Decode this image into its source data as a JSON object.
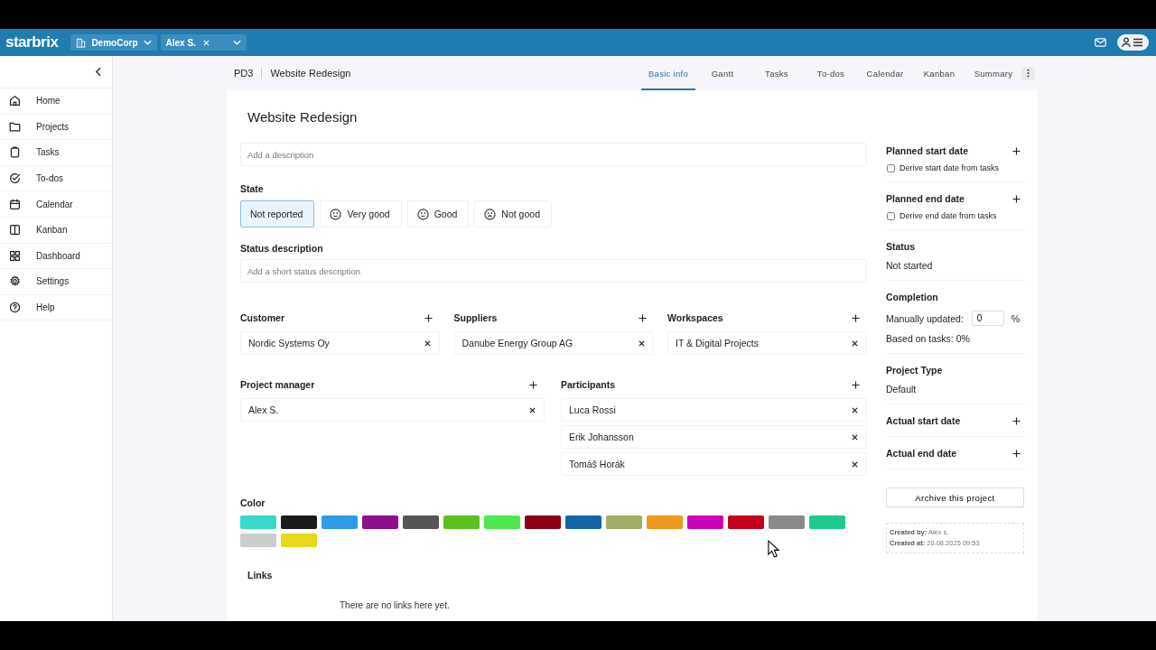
{
  "topbar": {
    "logo": "starbrix",
    "org": "DemoCorp",
    "user_filter": "Alex S."
  },
  "sidebar": {
    "items": [
      {
        "label": "Home"
      },
      {
        "label": "Projects"
      },
      {
        "label": "Tasks"
      },
      {
        "label": "To-dos"
      },
      {
        "label": "Calendar"
      },
      {
        "label": "Kanban"
      },
      {
        "label": "Dashboard"
      },
      {
        "label": "Settings"
      },
      {
        "label": "Help"
      }
    ]
  },
  "project": {
    "code": "PD3",
    "title": "Website Redesign"
  },
  "tabs": [
    {
      "label": "Basic info",
      "selected": true
    },
    {
      "label": "Gantt",
      "selected": false
    },
    {
      "label": "Tasks",
      "selected": false
    },
    {
      "label": "To-dos",
      "selected": false
    },
    {
      "label": "Calendar",
      "selected": false
    },
    {
      "label": "Kanban",
      "selected": false
    },
    {
      "label": "Summary",
      "selected": false
    }
  ],
  "form": {
    "title": "Website Redesign",
    "description_placeholder": "Add a description",
    "state_label": "State",
    "states": [
      {
        "label": "Not reported",
        "selected": true,
        "kind": "plain"
      },
      {
        "label": "Very good",
        "selected": false,
        "kind": "happy"
      },
      {
        "label": "Good",
        "selected": false,
        "kind": "neutral"
      },
      {
        "label": "Not good",
        "selected": false,
        "kind": "sad"
      }
    ],
    "status_description_label": "Status description",
    "status_description_placeholder": "Add a short status description",
    "groups": [
      {
        "label": "Customer",
        "items": [
          "Nordic Systems Oy"
        ]
      },
      {
        "label": "Suppliers",
        "items": [
          "Danube Energy Group AG"
        ]
      },
      {
        "label": "Workspaces",
        "items": [
          "IT & Digital Projects"
        ]
      }
    ],
    "people": [
      {
        "label": "Project manager",
        "items": [
          "Alex S."
        ]
      },
      {
        "label": "Participants",
        "items": [
          "Luca Rossi",
          "Erik Johansson",
          "Tomáš Horák"
        ]
      }
    ],
    "color_label": "Color",
    "swatches": [
      {
        "color": "#3ad8cc"
      },
      {
        "color": "#1a1a1a"
      },
      {
        "color": "#2f9be8"
      },
      {
        "color": "#8c0f8c"
      },
      {
        "color": "#555555"
      },
      {
        "color": "#5cc01e"
      },
      {
        "color": "#4de84d"
      },
      {
        "color": "#8b0015"
      },
      {
        "color": "#1565a6"
      },
      {
        "color": "#a0ad62"
      },
      {
        "color": "#eb9a1e"
      },
      {
        "color": "#cc00bb"
      },
      {
        "color": "#c4001a"
      },
      {
        "color": "#8a8a8a"
      },
      {
        "color": "#1fc98a"
      },
      {
        "color": "#cccccc"
      },
      {
        "color": "#e5d91a"
      }
    ],
    "links_label": "Links",
    "links_empty": "There are no links here yet."
  },
  "details": {
    "sections": [
      {
        "kind": "date",
        "label": "Planned start date",
        "checkbox": {
          "label": "Derive start date from tasks",
          "checked": false
        }
      },
      {
        "kind": "date",
        "label": "Planned end date",
        "checkbox": {
          "label": "Derive end date from tasks",
          "checked": false
        }
      },
      {
        "kind": "value",
        "label": "Status",
        "value": "Not started"
      },
      {
        "kind": "completion",
        "label": "Completion",
        "manual_label": "Manually updated:",
        "manual_value": "0",
        "unit": "%",
        "based": "Based on tasks: 0%"
      },
      {
        "kind": "value",
        "label": "Project Type",
        "value": "Default"
      },
      {
        "kind": "date",
        "label": "Actual start date"
      },
      {
        "kind": "date",
        "label": "Actual end date"
      }
    ],
    "archive_button": "Archive this project",
    "created_by_label": "Created by:",
    "created_by": "Alex s.",
    "created_at_label": "Created at:",
    "created_at": "20.08.2025 09:53"
  }
}
